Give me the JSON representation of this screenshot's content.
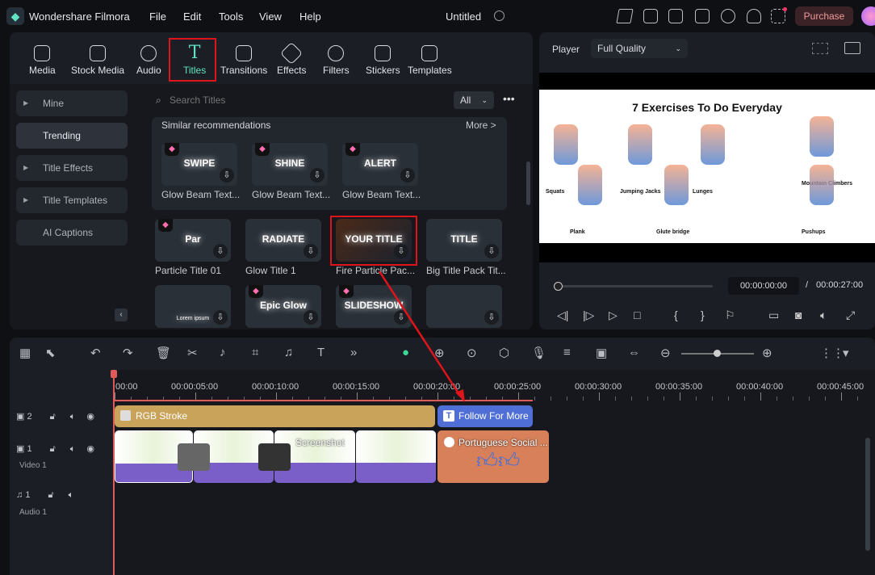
{
  "app": {
    "name": "Wondershare Filmora",
    "project_title": "Untitled",
    "menu": [
      "File",
      "Edit",
      "Tools",
      "View",
      "Help"
    ],
    "purchase_label": "Purchase",
    "accent": "#5fe3c2"
  },
  "tabs": [
    {
      "label": "Media",
      "icon": "media-icon"
    },
    {
      "label": "Stock Media",
      "icon": "stock-media-icon"
    },
    {
      "label": "Audio",
      "icon": "music-note-icon"
    },
    {
      "label": "Titles",
      "icon": "text-t-icon",
      "active": true
    },
    {
      "label": "Transitions",
      "icon": "transitions-icon"
    },
    {
      "label": "Effects",
      "icon": "effects-star-icon"
    },
    {
      "label": "Filters",
      "icon": "filters-icon"
    },
    {
      "label": "Stickers",
      "icon": "stickers-icon"
    },
    {
      "label": "Templates",
      "icon": "templates-icon"
    }
  ],
  "sidebar": [
    {
      "label": "Mine",
      "expandable": true
    },
    {
      "label": "Trending",
      "active": true
    },
    {
      "label": "Title Effects",
      "expandable": true
    },
    {
      "label": "Title Templates",
      "expandable": true
    },
    {
      "label": "AI Captions"
    }
  ],
  "search": {
    "placeholder": "Search Titles",
    "filter": "All"
  },
  "recommendations": {
    "header": "Similar recommendations",
    "more": "More >",
    "items": [
      {
        "label": "Glow Beam Text...",
        "thumb": "SWIPE",
        "premium": true
      },
      {
        "label": "Glow Beam Text...",
        "thumb": "SHINE",
        "premium": true
      },
      {
        "label": "Glow Beam Text...",
        "thumb": "ALERT",
        "premium": true
      }
    ]
  },
  "titles": [
    {
      "label": "Particle Title 01",
      "thumb": "Par",
      "premium": true
    },
    {
      "label": "Glow Title 1",
      "thumb": "RADIATE"
    },
    {
      "label": "Fire Particle Pac...",
      "thumb": "YOUR TITLE",
      "highlighted": true
    },
    {
      "label": "Big Title Pack Tit...",
      "thumb": "TITLE"
    },
    {
      "label": "",
      "thumb": "Lorem ipsum"
    },
    {
      "label": "",
      "thumb": "Epic Glow",
      "premium": true
    },
    {
      "label": "",
      "thumb": "SLIDESHOW",
      "premium": true
    },
    {
      "label": "",
      "thumb": ""
    }
  ],
  "player": {
    "label": "Player",
    "quality": "Full Quality",
    "current_time": "00:00:00:00",
    "separator": "/",
    "total_time": "00:00:27:00",
    "progress": 0,
    "preview": {
      "title": "7 Exercises To Do Everyday",
      "exercises": [
        "Squats",
        "Jumping Jacks",
        "Lunges",
        "Mountain Climbers",
        "Plank",
        "Glute bridge",
        "Pushups"
      ]
    }
  },
  "timeline": {
    "ticks": [
      "00:00",
      "00:00:05:00",
      "00:00:10:00",
      "00:00:15:00",
      "00:00:20:00",
      "00:00:25:00",
      "00:00:30:00",
      "00:00:35:00",
      "00:00:40:00",
      "00:00:45:00"
    ],
    "tracks": [
      {
        "number": "2",
        "name": ""
      },
      {
        "number": "1",
        "name": "Video 1"
      },
      {
        "number": "1",
        "name": "Audio 1"
      }
    ],
    "track2_clips": [
      {
        "label": "RGB Stroke",
        "color": "#c9a35a"
      },
      {
        "label": "Follow For More",
        "color": "#4f6fd6"
      }
    ],
    "track1_clips": [
      {
        "label": "",
        "color": "#7b5fc9"
      },
      {
        "label": "",
        "color": "#7b5fc9"
      },
      {
        "label": "Screenshot",
        "color": "#7b5fc9"
      },
      {
        "label": "",
        "color": "#7b5fc9"
      },
      {
        "label": "Portuguese Social ...",
        "color": "#d7805a"
      }
    ]
  }
}
